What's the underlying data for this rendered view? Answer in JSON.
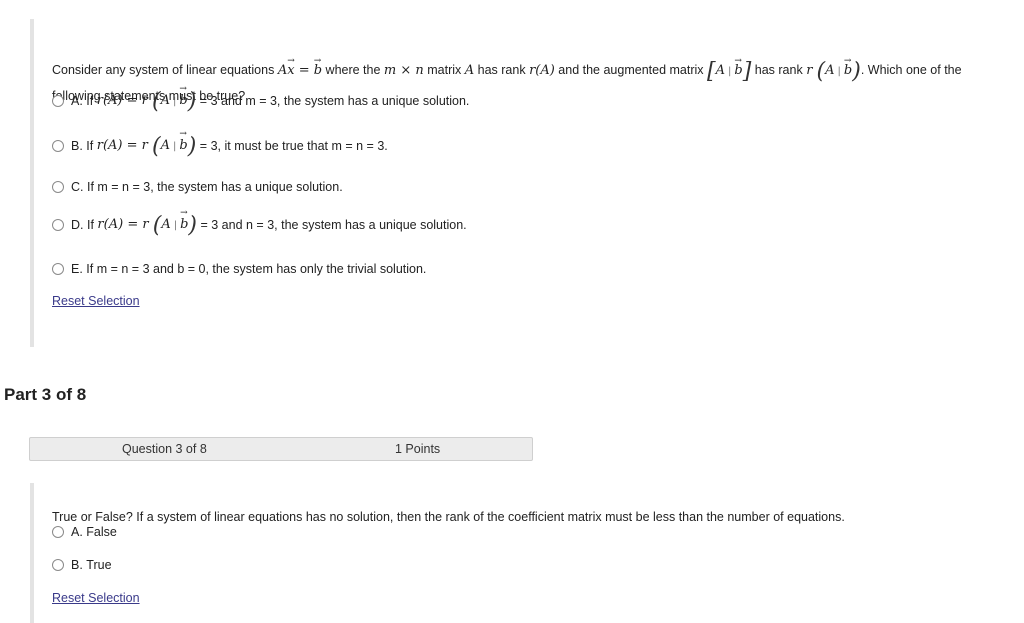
{
  "question1": {
    "stem_parts": {
      "p1": "Consider any system of linear equations ",
      "p2": " where the ",
      "p3": " matrix ",
      "p4": " has rank ",
      "p5": " and the augmented matrix ",
      "p6": " has rank ",
      "p7": ". Which one of the following statements must be true?"
    },
    "options": [
      {
        "letter": "A.",
        "pre": "If",
        "post": "= 3 and m = 3, the system has a unique solution.",
        "selected": false
      },
      {
        "letter": "B.",
        "pre": "If",
        "post": "= 3, it must be true that m = n = 3.",
        "selected": false
      },
      {
        "letter": "C.",
        "text": "If m = n = 3, the system has a unique solution.",
        "selected": false
      },
      {
        "letter": "D.",
        "pre": "If",
        "post": "= 3 and n = 3, the system has a unique solution.",
        "selected": false
      },
      {
        "letter": "E.",
        "text": "If m = n = 3 and b = 0, the system has only the trivial solution.",
        "selected": false
      }
    ],
    "reset_label": "Reset Selection"
  },
  "part": {
    "title": "Part 3 of 8"
  },
  "question2_header": {
    "question_number": "Question 3 of 8",
    "points": "1 Points"
  },
  "question2": {
    "stem": "True or False? If a system of linear equations has no solution, then the rank of the coefficient matrix must be less than the number of equations.",
    "options": [
      {
        "letter": "A.",
        "text": "False",
        "selected": false
      },
      {
        "letter": "B.",
        "text": "True",
        "selected": false
      }
    ],
    "reset_label": "Reset Selection"
  },
  "colors": {
    "link": "#3a3a8a",
    "border_bar": "#e3e3e3",
    "header_bg": "#ececec"
  }
}
